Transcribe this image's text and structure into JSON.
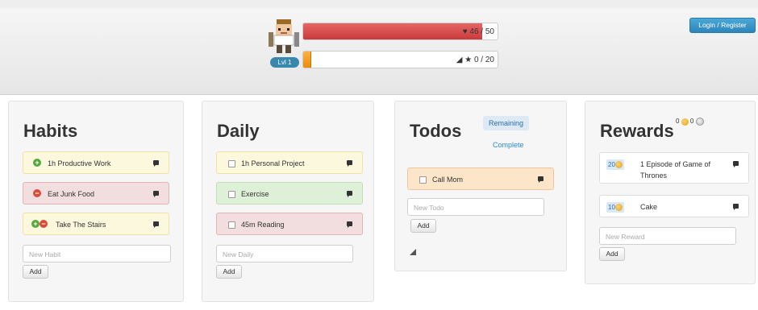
{
  "header": {
    "login_label": "Login / Register",
    "level_label": "Lvl 1",
    "hp_text": "46 / 50",
    "hp_fraction": 0.92,
    "xp_text": "0 / 20",
    "xp_fraction": 0.0
  },
  "habits": {
    "title": "Habits",
    "items": [
      {
        "label": "1h Productive Work"
      },
      {
        "label": "Eat Junk Food"
      },
      {
        "label": "Take The Stairs"
      }
    ],
    "input_placeholder": "New Habit",
    "add_label": "Add"
  },
  "daily": {
    "title": "Daily",
    "items": [
      {
        "label": "1h Personal Project"
      },
      {
        "label": "Exercise"
      },
      {
        "label": "45m Reading"
      }
    ],
    "input_placeholder": "New Daily",
    "add_label": "Add"
  },
  "todos": {
    "title": "Todos",
    "tab_remaining": "Remaining",
    "tab_complete": "Complete",
    "items": [
      {
        "label": "Call Mom"
      }
    ],
    "input_placeholder": "New Todo",
    "add_label": "Add"
  },
  "rewards": {
    "title": "Rewards",
    "gold": "0",
    "silver": "0",
    "items": [
      {
        "price": "20",
        "label": "1 Episode of Game of Thrones"
      },
      {
        "price": "10",
        "label": "Cake"
      }
    ],
    "input_placeholder": "New Reward",
    "add_label": "Add"
  },
  "colors": {
    "hp": "#d94a4a",
    "xp": "#f0a030",
    "link": "#2a8ad4"
  }
}
